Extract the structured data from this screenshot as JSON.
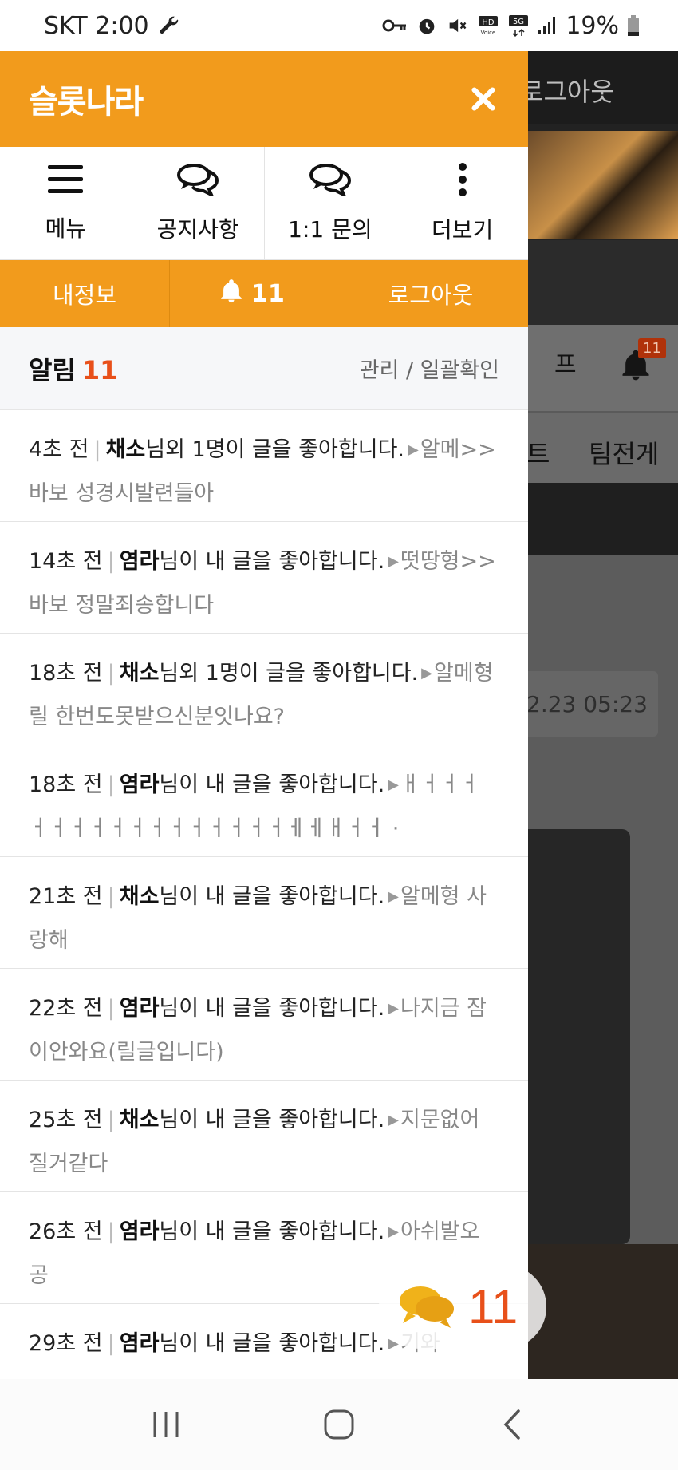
{
  "status_bar": {
    "carrier_time": "SKT 2:00",
    "battery": "19%"
  },
  "background_page": {
    "header_logout": "로그아웃",
    "tab_label": "프",
    "bell_badge": "11",
    "nav_item_1": "트",
    "nav_item_2": "팀전게",
    "date": "2.23 05:23"
  },
  "drawer": {
    "title": "슬롯나라",
    "quick_menu": [
      {
        "label": "메뉴",
        "icon": "hamburger-icon"
      },
      {
        "label": "공지사항",
        "icon": "chat-bubbles-icon"
      },
      {
        "label": "1:1 문의",
        "icon": "chat-bubbles-icon"
      },
      {
        "label": "더보기",
        "icon": "more-vertical-icon"
      }
    ],
    "action_bar": {
      "my_info": "내정보",
      "bell_count": "11",
      "logout": "로그아웃"
    },
    "alarm": {
      "title": "알림",
      "count": "11",
      "manage": "관리 / 일괄확인"
    },
    "notifications": [
      {
        "time": "4초 전",
        "user": "채소",
        "message": "님외 1명이 글을 좋아합니다.",
        "post": "알메>>바보 성경시발련들아"
      },
      {
        "time": "14초 전",
        "user": "염라",
        "message": "님이 내 글을 좋아합니다.",
        "post": "떳땅형>>바보 정말죄송합니다"
      },
      {
        "time": "18초 전",
        "user": "채소",
        "message": "님외 1명이 글을 좋아합니다.",
        "post": "알메형 릴 한번도못받으신분잇나요?"
      },
      {
        "time": "18초 전",
        "user": "염라",
        "message": "님이 내 글을 좋아합니다.",
        "post": "ㅐㅓㅓㅓㅓㅓㅓㅓㅓㅓㅓㅓㅓㅓㅓㅓㅓㅔㅔㅐㅓㅓ ·"
      },
      {
        "time": "21초 전",
        "user": "채소",
        "message": "님이 내 글을 좋아합니다.",
        "post": "알메형 사랑해"
      },
      {
        "time": "22초 전",
        "user": "염라",
        "message": "님이 내 글을 좋아합니다.",
        "post": "나지금 잠이안와요(릴글입니다)"
      },
      {
        "time": "25초 전",
        "user": "채소",
        "message": "님이 내 글을 좋아합니다.",
        "post": "지문없어질거같다"
      },
      {
        "time": "26초 전",
        "user": "염라",
        "message": "님이 내 글을 좋아합니다.",
        "post": "아쉬발오공"
      },
      {
        "time": "29초 전",
        "user": "염라",
        "message": "님이 내 글을 좋아합니다.",
        "post": "기와"
      }
    ]
  },
  "chat_float": {
    "count": "11"
  },
  "colors": {
    "accent": "#f29b1c",
    "count": "#e8501a"
  }
}
